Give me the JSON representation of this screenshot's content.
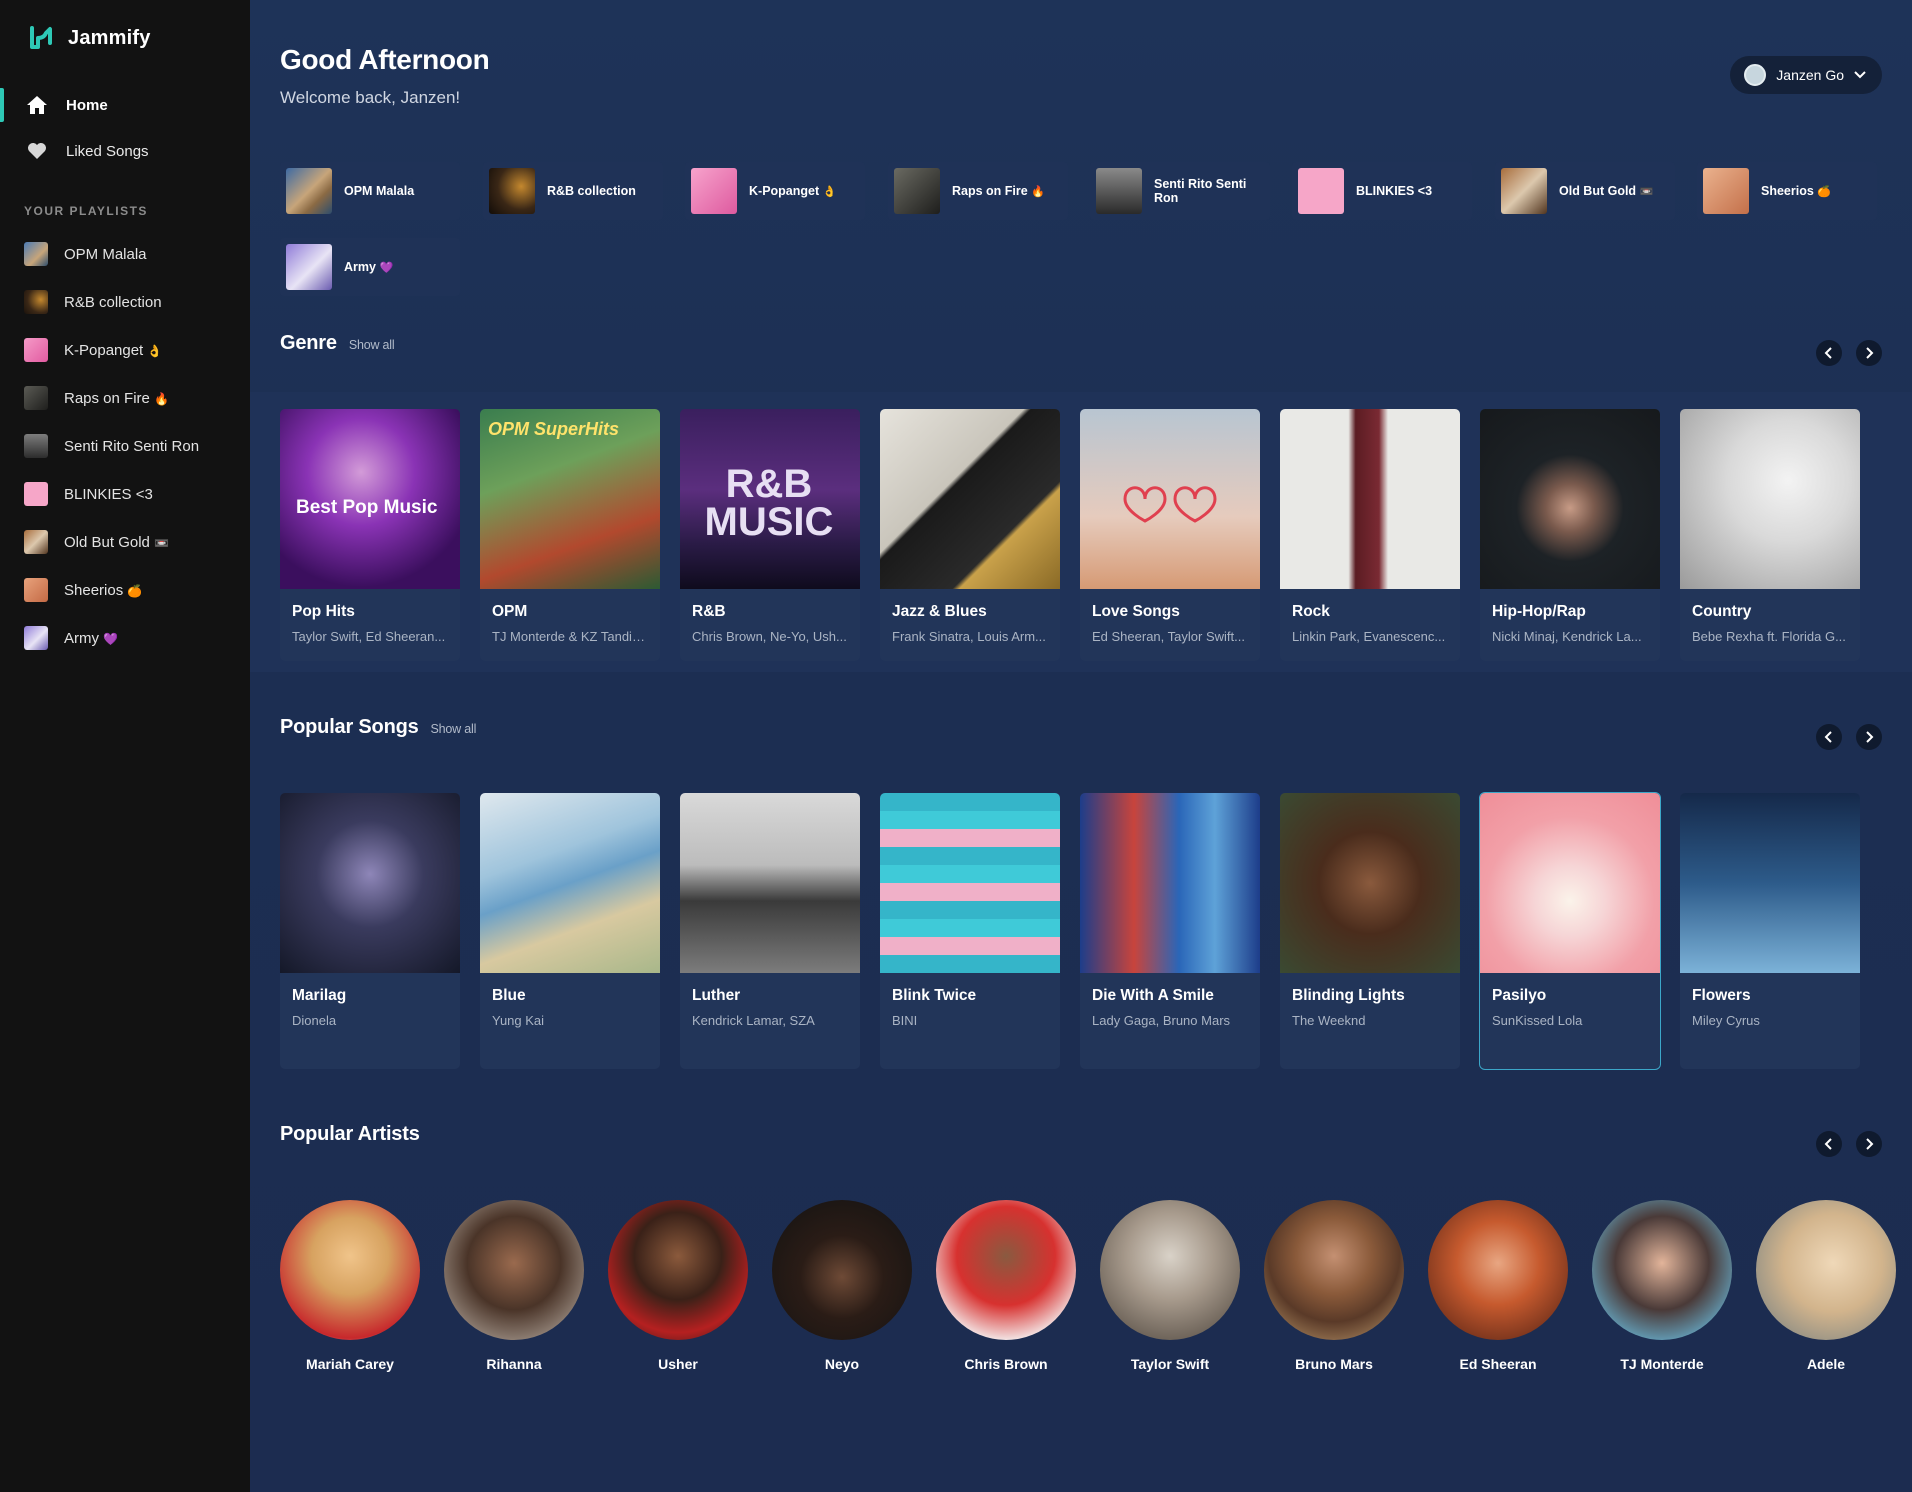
{
  "app": {
    "name": "Jammify",
    "accent": "#2ec9b6"
  },
  "nav": [
    {
      "label": "Home",
      "icon": "home-icon",
      "active": true
    },
    {
      "label": "Liked Songs",
      "icon": "heart-icon",
      "active": false
    }
  ],
  "sidebar_section": "YOUR PLAYLISTS",
  "playlists": [
    {
      "label": "OPM Malala",
      "emoji": ""
    },
    {
      "label": "R&B collection",
      "emoji": ""
    },
    {
      "label": "K-Popanget",
      "emoji": "👌"
    },
    {
      "label": "Raps on Fire",
      "emoji": "🔥"
    },
    {
      "label": "Senti Rito Senti Ron",
      "emoji": ""
    },
    {
      "label": "BLINKIES <3",
      "emoji": ""
    },
    {
      "label": "Old But Gold",
      "emoji": "📼"
    },
    {
      "label": "Sheerios",
      "emoji": "🍊"
    },
    {
      "label": "Army",
      "emoji": "💜"
    }
  ],
  "header": {
    "greeting": "Good Afternoon",
    "welcome": "Welcome back, Janzen!",
    "user": "Janzen Go"
  },
  "sections": {
    "genre": {
      "title": "Genre",
      "show_all": "Show all"
    },
    "popular_songs": {
      "title": "Popular Songs",
      "show_all": "Show all"
    },
    "popular_artists": {
      "title": "Popular Artists"
    }
  },
  "genres": [
    {
      "title": "Pop Hits",
      "sub": "Taylor Swift, Ed Sheeran...",
      "cover_text": "Best Pop Music"
    },
    {
      "title": "OPM",
      "sub": "TJ Monterde & KZ Tandin...",
      "cover_text": "OPM SuperHits"
    },
    {
      "title": "R&B",
      "sub": "Chris Brown, Ne-Yo, Ush...",
      "cover_text": "R&B MUSIC"
    },
    {
      "title": "Jazz & Blues",
      "sub": "Frank Sinatra, Louis Arm..."
    },
    {
      "title": "Love Songs",
      "sub": "Ed Sheeran, Taylor Swift..."
    },
    {
      "title": "Rock",
      "sub": "Linkin Park, Evanescenc..."
    },
    {
      "title": "Hip-Hop/Rap",
      "sub": "Nicki Minaj, Kendrick La..."
    },
    {
      "title": "Country",
      "sub": "Bebe Rexha ft. Florida G..."
    }
  ],
  "songs": [
    {
      "title": "Marilag",
      "sub": "Dionela"
    },
    {
      "title": "Blue",
      "sub": "Yung Kai"
    },
    {
      "title": "Luther",
      "sub": "Kendrick Lamar, SZA"
    },
    {
      "title": "Blink Twice",
      "sub": "BINI"
    },
    {
      "title": "Die With A Smile",
      "sub": "Lady Gaga, Bruno Mars"
    },
    {
      "title": "Blinding Lights",
      "sub": "The Weeknd"
    },
    {
      "title": "Pasilyo",
      "sub": "SunKissed Lola"
    },
    {
      "title": "Flowers",
      "sub": "Miley Cyrus"
    }
  ],
  "artists": [
    {
      "name": "Mariah Carey"
    },
    {
      "name": "Rihanna"
    },
    {
      "name": "Usher"
    },
    {
      "name": "Neyo"
    },
    {
      "name": "Chris Brown"
    },
    {
      "name": "Taylor Swift"
    },
    {
      "name": "Bruno Mars"
    },
    {
      "name": "Ed Sheeran"
    },
    {
      "name": "TJ Monterde"
    },
    {
      "name": "Adele"
    }
  ]
}
